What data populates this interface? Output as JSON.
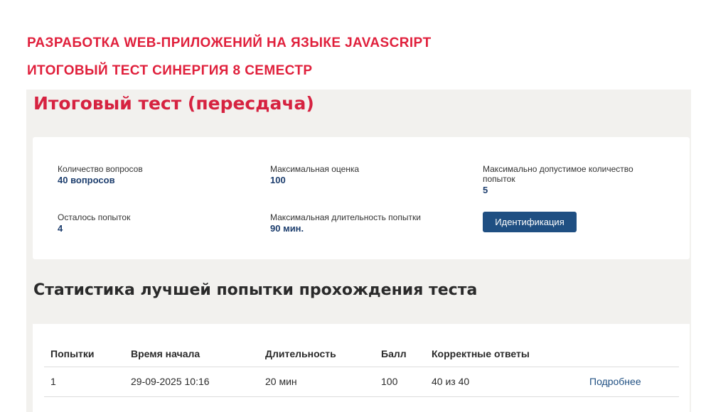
{
  "banner": {
    "line1": "РАЗРАБОТКА WEB-ПРИЛОЖЕНИЙ НА ЯЗЫКЕ JAVASCRIPT",
    "line2": "ИТОГОВЫЙ ТЕСТ СИНЕРГИЯ 8 СЕМЕСТР"
  },
  "page_title": "Итоговый тест (пересдача)",
  "info": {
    "questions": {
      "label": "Количество вопросов",
      "value": "40 вопросов"
    },
    "max_score": {
      "label": "Максимальная оценка",
      "value": "100"
    },
    "max_attempts": {
      "label": "Максимально допустимое количество попыток",
      "value": "5"
    },
    "attempts_left": {
      "label": "Осталось попыток",
      "value": "4"
    },
    "max_duration": {
      "label": "Максимальная длительность попытки",
      "value": "90 мин."
    }
  },
  "identification_button": "Идентификация",
  "stats_title": "Статистика лучшей попытки прохождения теста",
  "table": {
    "headers": [
      "Попытки",
      "Время начала",
      "Длительность",
      "Балл",
      "Корректные ответы",
      ""
    ],
    "rows": [
      {
        "attempt": "1",
        "start": "29-09-2025 10:16",
        "duration": "20 мин",
        "score": "100",
        "correct": "40 из 40",
        "link": "Подробнее"
      }
    ]
  },
  "colors": {
    "accent_red": "#e0203c",
    "title_red": "#d62240",
    "primary_blue": "#1f4f82",
    "value_blue": "#1d3e6e",
    "panel_bg": "#f2f1ee"
  }
}
